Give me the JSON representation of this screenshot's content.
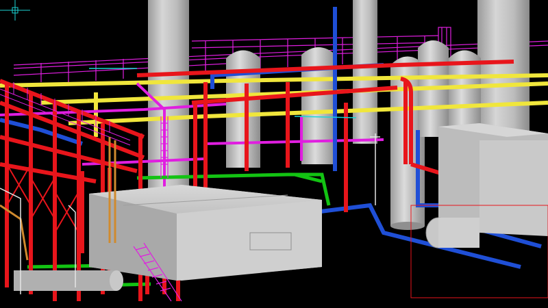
{
  "viewport": {
    "background": "#000000",
    "view_style": "3D shaded plant model",
    "cursor": "crosshair-icon"
  },
  "colors": {
    "steel": "#e8151b",
    "pipe_yellow": "#f0e63c",
    "pipe_blue": "#1f4fd6",
    "pipe_magenta": "#e01ee0",
    "pipe_green": "#13c313",
    "vessel_gray": "#b9b9b9",
    "vessel_shadow": "#8f8f8f",
    "equipment_gray": "#c8c8c8",
    "orange": "#d08a2e",
    "white_rail": "#e6e6e6",
    "cyan": "#1bd6d6"
  },
  "objects": [
    {
      "name": "vertical-column",
      "count": 5
    },
    {
      "name": "horizontal-vessel",
      "count": 1
    },
    {
      "name": "equipment-box",
      "count": 2
    },
    {
      "name": "pipe-rack",
      "count": 2
    },
    {
      "name": "stair",
      "count": 2
    }
  ]
}
